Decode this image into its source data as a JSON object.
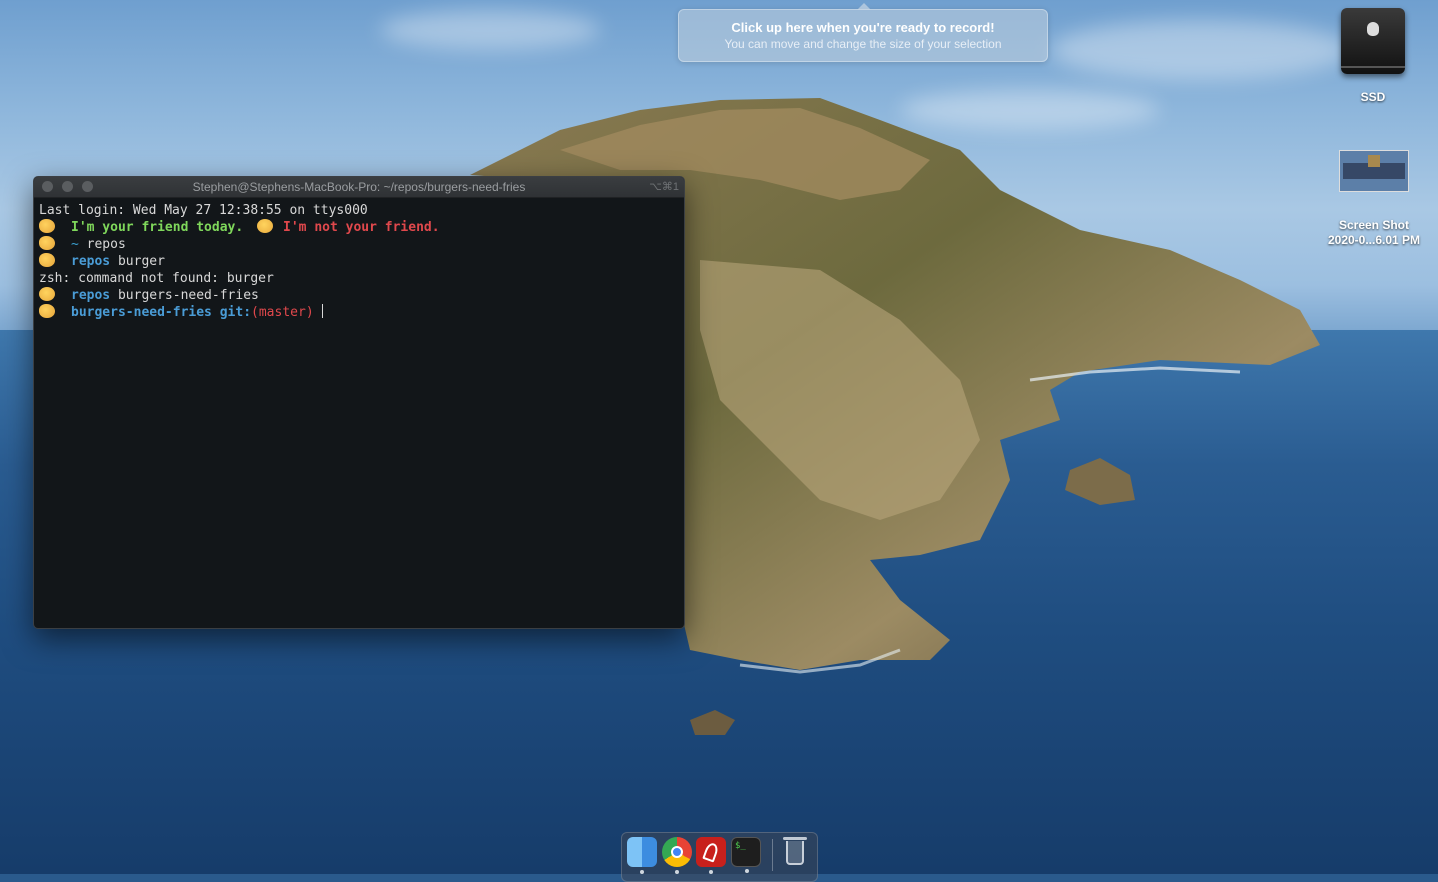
{
  "desktop": {
    "record_hint": {
      "title": "Click up here when you're ready to record!",
      "subtitle": "You can move and change the size of your selection"
    },
    "icons": {
      "drive_label": "SSD",
      "screenshot_label_line1": "Screen Shot",
      "screenshot_label_line2": "2020-0...6.01 PM"
    }
  },
  "terminal": {
    "title": "Stephen@Stephens-MacBook-Pro: ~/repos/burgers-need-fries",
    "shortcut": "⌥⌘1",
    "lines": {
      "last_login": "Last login: Wed May 27 12:38:55 on ttys000",
      "friend_good": "I'm your friend today.",
      "friend_bad": "I'm not your friend.",
      "prompt1_dir": "~",
      "prompt1_cmd": "repos",
      "prompt2_dir": "repos",
      "prompt2_cmd": "burger",
      "error": "zsh: command not found: burger",
      "prompt3_dir": "repos",
      "prompt3_cmd": "burgers-need-fries",
      "prompt4_dir": "burgers-need-fries",
      "prompt4_git": "git:",
      "prompt4_branch": "(master)"
    }
  },
  "dock": {
    "items": [
      "finder-icon",
      "chrome-icon",
      "acrobat-icon",
      "terminal-icon",
      "trash-icon"
    ]
  },
  "colors": {
    "prompt_green": "#7fd75b",
    "prompt_red": "#e0484c",
    "dir_blue": "#4a9cd6",
    "terminal_bg": "#121619"
  }
}
